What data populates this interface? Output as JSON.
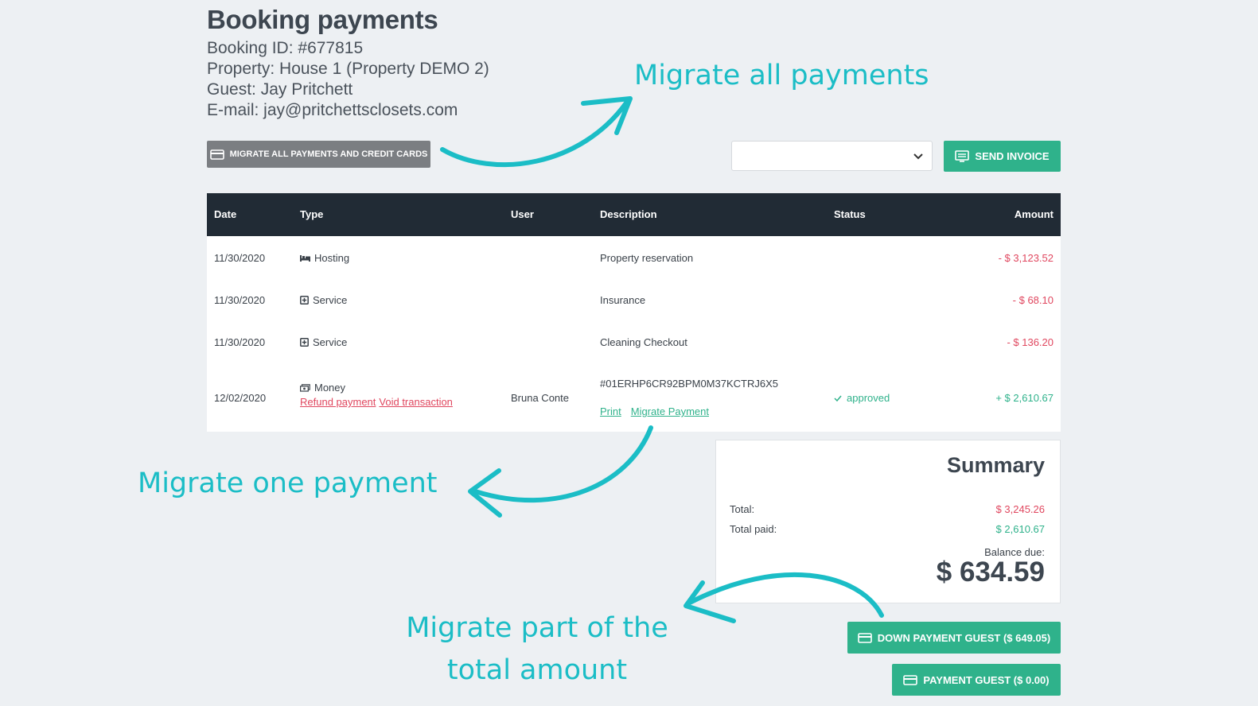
{
  "header": {
    "title": "Booking payments",
    "booking_id": "Booking ID: #677815",
    "property": "Property: House 1 (Property DEMO 2)",
    "guest": "Guest: Jay Pritchett",
    "email": "E-mail: jay@pritchettsclosets.com"
  },
  "actions": {
    "migrate_all_label": "MIGRATE ALL PAYMENTS AND CREDIT CARDS",
    "select_value": "",
    "send_invoice_label": "SEND INVOICE"
  },
  "table": {
    "columns": [
      "Date",
      "Type",
      "User",
      "Description",
      "Status",
      "Amount"
    ],
    "rows": [
      {
        "date": "11/30/2020",
        "type": "Hosting",
        "type_icon": "bed-icon",
        "user": "",
        "description": "Property reservation",
        "status": "",
        "amount": "- $ 3,123.52"
      },
      {
        "date": "11/30/2020",
        "type": "Service",
        "type_icon": "plus-box-icon",
        "user": "",
        "description": "Insurance",
        "status": "",
        "amount": "- $ 68.10"
      },
      {
        "date": "11/30/2020",
        "type": "Service",
        "type_icon": "plus-box-icon",
        "user": "",
        "description": "Cleaning Checkout",
        "status": "",
        "amount": "- $ 136.20"
      },
      {
        "date": "12/02/2020",
        "type": "Money",
        "type_icon": "money-icon",
        "refund_label": "Refund payment",
        "void_label": "Void transaction",
        "user": "Bruna Conte",
        "description": "#01ERHP6CR92BPM0M37KCTRJ6X5",
        "print_label": "Print",
        "migrate_label": "Migrate Payment",
        "status": "approved",
        "amount": "+ $ 2,610.67"
      }
    ]
  },
  "summary": {
    "title": "Summary",
    "total_label": "Total:",
    "total_value": "$ 3,245.26",
    "paid_label": "Total paid:",
    "paid_value": "$ 2,610.67",
    "balance_label": "Balance due:",
    "balance_value": "$ 634.59"
  },
  "payments": {
    "down_payment_label": "DOWN PAYMENT GUEST ($ 649.05)",
    "payment_label": "PAYMENT GUEST ($ 0.00)"
  },
  "annotations": {
    "migrate_all": "Migrate all payments",
    "migrate_one": "Migrate one payment",
    "migrate_part_line1": "Migrate part of the",
    "migrate_part_line2": "total amount"
  },
  "colors": {
    "accent_green": "#2fb28b",
    "negative_red": "#e0475f",
    "annotation_teal": "#1bbdc6",
    "table_header": "#212b35"
  }
}
